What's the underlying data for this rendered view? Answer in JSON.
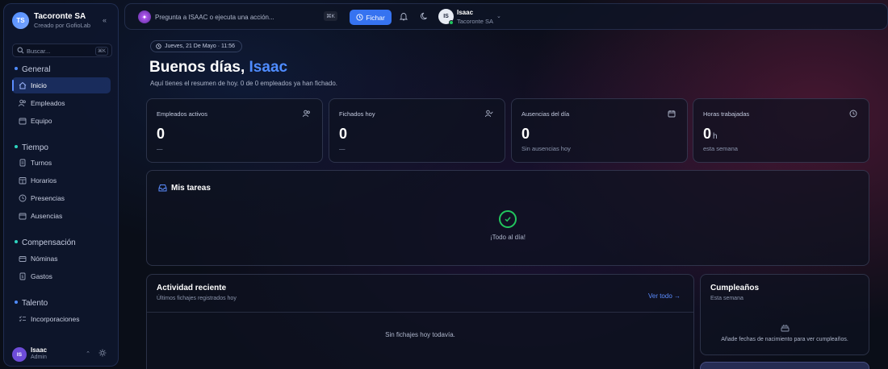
{
  "org": {
    "initials": "TS",
    "name": "Tacoronte SA",
    "subtitle": "Creado por GofioLab"
  },
  "sidebar": {
    "search_placeholder": "Buscar...",
    "search_kbd": "⌘K",
    "sections": [
      {
        "title": "General",
        "color": "#4f8cff"
      },
      {
        "title": "Tiempo",
        "color": "#2dd4bf"
      },
      {
        "title": "Compensación",
        "color": "#2dd4bf"
      },
      {
        "title": "Talento",
        "color": "#4f8cff"
      }
    ],
    "items": [
      {
        "label": "Inicio",
        "icon": "home-icon"
      },
      {
        "label": "Empleados",
        "icon": "users-icon"
      },
      {
        "label": "Equipo",
        "icon": "calendar-icon"
      },
      {
        "label": "Turnos",
        "icon": "document-icon"
      },
      {
        "label": "Horarios",
        "icon": "calendar-grid-icon"
      },
      {
        "label": "Presencias",
        "icon": "clock-icon"
      },
      {
        "label": "Ausencias",
        "icon": "calendar-icon"
      },
      {
        "label": "Nóminas",
        "icon": "wallet-icon"
      },
      {
        "label": "Gastos",
        "icon": "receipt-icon"
      },
      {
        "label": "Incorporaciones",
        "icon": "checklist-icon"
      }
    ],
    "user": {
      "initials": "IS",
      "name": "Isaac",
      "role": "Admin"
    }
  },
  "topbar": {
    "ai_placeholder": "Pregunta a ISAAC o ejecuta una acción...",
    "ai_kbd": "⌘K",
    "fichar_label": "Fichar",
    "user_initials": "IS",
    "user_name": "Isaac",
    "user_org": "Tacoronte SA"
  },
  "main": {
    "date": "Jueves, 21 De Mayo · 11:56",
    "greeting_prefix": "Buenos días,",
    "greeting_name": "Isaac",
    "subtitle": "Aquí tienes el resumen de hoy. 0 de 0 empleados ya han fichado.",
    "stats": [
      {
        "label": "Empleados activos",
        "value": "0",
        "unit": "",
        "sub": "—",
        "icon": "users-icon"
      },
      {
        "label": "Fichados hoy",
        "value": "0",
        "unit": "",
        "sub": "—",
        "icon": "user-check-icon"
      },
      {
        "label": "Ausencias del día",
        "value": "0",
        "unit": "",
        "sub": "Sin ausencias hoy",
        "icon": "calendar-icon"
      },
      {
        "label": "Horas trabajadas",
        "value": "0",
        "unit": "h",
        "sub": "esta semana",
        "icon": "clock-icon"
      }
    ],
    "tasks": {
      "title": "Mis tareas",
      "empty": "¡Todo al día!"
    },
    "activity": {
      "title": "Actividad reciente",
      "subtitle": "Últimos fichajes registrados hoy",
      "link": "Ver todo →",
      "empty": "Sin fichajes hoy todavía."
    },
    "birthdays": {
      "title": "Cumpleaños",
      "subtitle": "Esta semana",
      "empty": "Añade fechas de nacimiento para ver cumpleaños."
    }
  }
}
